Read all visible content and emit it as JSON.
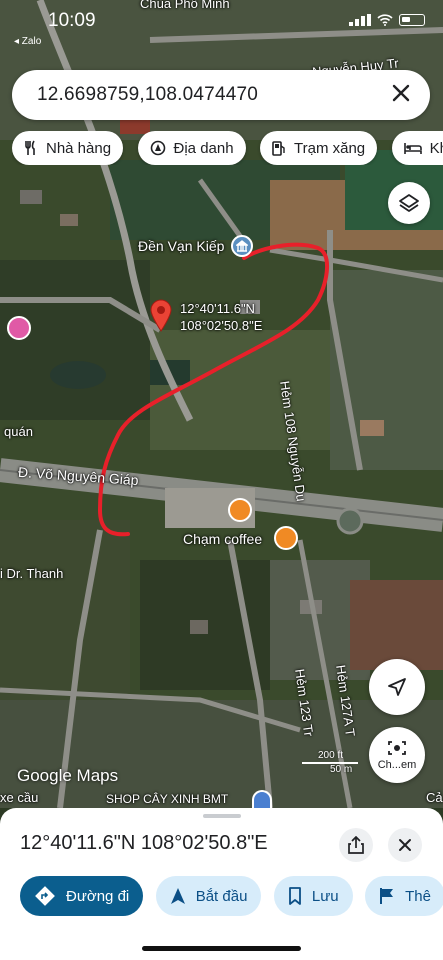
{
  "status_bar": {
    "time": "10:09",
    "back_app": "◂ Zalo"
  },
  "search": {
    "value": "12.6698759,108.0474470",
    "close_icon": "close-icon"
  },
  "chips": [
    {
      "label": "Nhà hàng",
      "icon": "restaurant-icon"
    },
    {
      "label": "Địa danh",
      "icon": "landmark-icon"
    },
    {
      "label": "Trạm xăng",
      "icon": "gas-station-icon"
    },
    {
      "label": "Khách",
      "icon": "hotel-icon"
    }
  ],
  "map": {
    "labels": {
      "top_place": "Chùa Phổ Minh",
      "top_road": "Nguyễn Huy Tr",
      "temple": "Đền Vạn Kiếp",
      "pin_coords_line1": "12°40'11.6\"N",
      "pin_coords_line2": "108°02'50.8\"E",
      "alley_108": "Hẻm 108 Nguyễn Du",
      "quan": "quán",
      "road_main": "Đ. Võ Nguyên Giáp",
      "cafe": "Chạm coffee",
      "dr": "i Dr. Thanh",
      "alley_123": "Hẻm 123 Tr",
      "alley_127": "Hẻm 127A T",
      "bottom_left": "xe cầu",
      "bottom_shop": "SHOP CÂY XINH BMT",
      "bottom_right": "Cả"
    },
    "google_logo": "Google Maps",
    "scale": {
      "upper": "200 ft",
      "lower": "50 m"
    },
    "colors": {
      "route": "#e8202a",
      "pin": "#ea4335"
    }
  },
  "fabs": {
    "lens_label": "Ch...em"
  },
  "sheet": {
    "title": "12°40'11.6\"N 108°02'50.8\"E",
    "actions": [
      {
        "label": "Đường đi",
        "icon": "directions-icon"
      },
      {
        "label": "Bắt đầu",
        "icon": "navigation-icon"
      },
      {
        "label": "Lưu",
        "icon": "bookmark-icon"
      },
      {
        "label": "Thê",
        "icon": "flag-icon"
      }
    ]
  }
}
